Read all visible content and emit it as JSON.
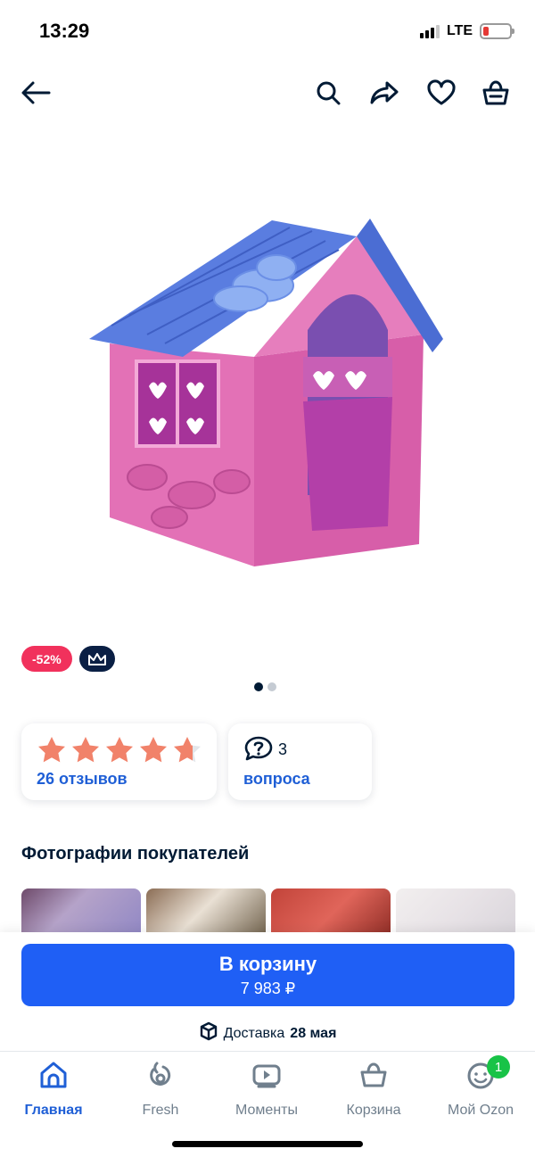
{
  "status_bar": {
    "time": "13:29",
    "network": "LTE"
  },
  "top_nav": {
    "back_icon": "arrow-left-icon",
    "icons": [
      "search-icon",
      "share-icon",
      "heart-icon",
      "cart-icon"
    ]
  },
  "product": {
    "image_description": "pink plastic playhouse",
    "discount_badge": "-52%",
    "premium_badge_icon": "crown-icon",
    "gallery_pages": 2,
    "gallery_active": 1
  },
  "rating_card": {
    "stars": 4.5,
    "reviews_label": "26 отзывов"
  },
  "questions_card": {
    "count": "3",
    "label": "вопроса"
  },
  "customer_photos": {
    "title": "Фотографии покупателей"
  },
  "buy_panel": {
    "button_label": "В корзину",
    "price": "7 983 ₽",
    "delivery_prefix": "Доставка",
    "delivery_date": "28 мая"
  },
  "tab_bar": {
    "tabs": [
      {
        "label": "Главная",
        "icon": "home-icon",
        "active": true
      },
      {
        "label": "Fresh",
        "icon": "fresh-icon",
        "active": false
      },
      {
        "label": "Моменты",
        "icon": "moments-icon",
        "active": false
      },
      {
        "label": "Корзина",
        "icon": "basket-icon",
        "active": false
      },
      {
        "label": "Мой Ozon",
        "icon": "profile-icon",
        "active": false,
        "badge": "1"
      }
    ]
  },
  "colors": {
    "accent": "#1f5ff5",
    "link": "#1f5fd6",
    "discount": "#f1315c",
    "star": "#f1826a",
    "badge_green": "#18c347"
  }
}
